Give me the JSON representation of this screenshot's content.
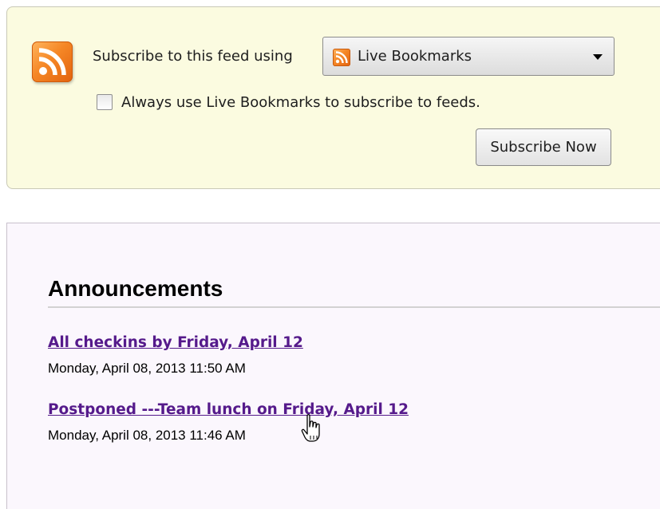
{
  "subscribe": {
    "label": "Subscribe to this feed using",
    "reader_selected": "Live Bookmarks",
    "always_use_label": "Always use Live Bookmarks to subscribe to feeds.",
    "always_use_checked": false,
    "button_label": "Subscribe Now",
    "feed_icon": "rss-feed-icon"
  },
  "announcements": {
    "heading": "Announcements",
    "items": [
      {
        "title": "All checkins by Friday, April 12",
        "date": "Monday, April 08, 2013 11:50 AM"
      },
      {
        "title": "Postponed ---Team lunch on Friday, April 12",
        "date": "Monday, April 08, 2013 11:46 AM"
      }
    ]
  },
  "colors": {
    "header_background": "#fbfbe0",
    "content_background": "#fbf7fd",
    "visited_link": "#551a8b",
    "feed_orange": "#f58726"
  },
  "cursor": "hand-pointer-icon"
}
